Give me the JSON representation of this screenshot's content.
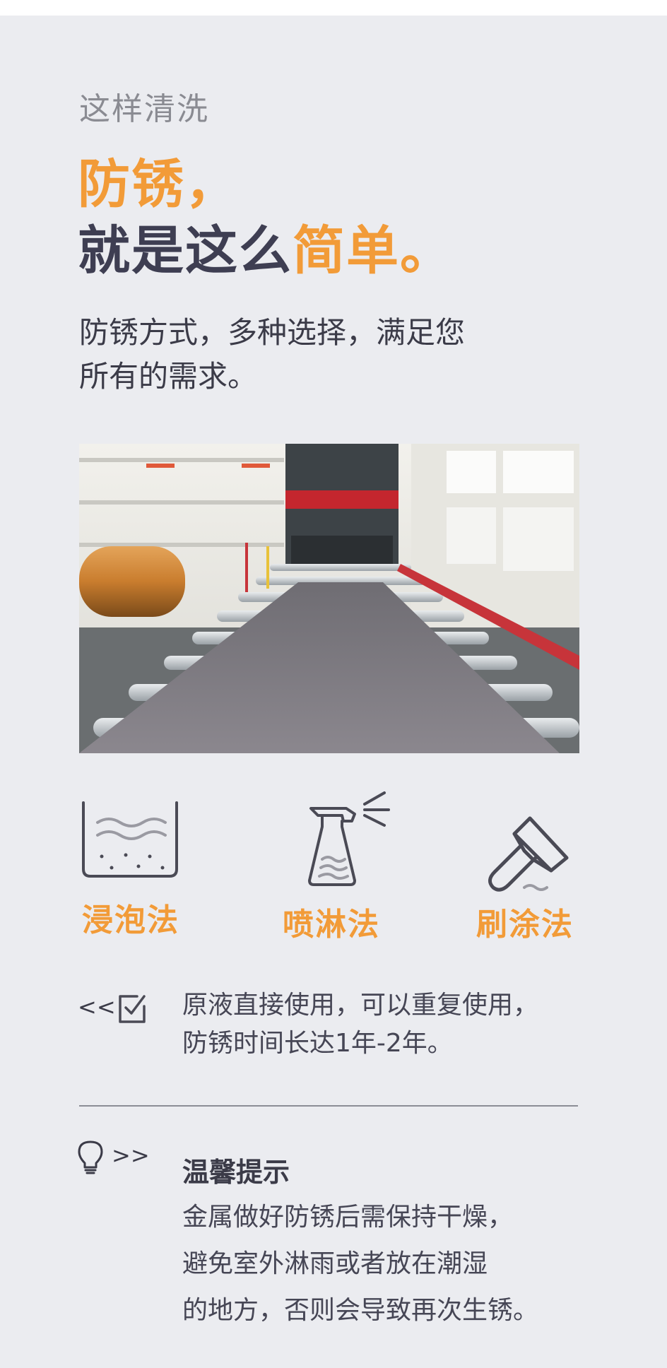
{
  "header": {
    "subtitle": "这样清洗",
    "headline_line1": "防锈，",
    "headline_line2_prefix": "就是这么",
    "headline_line2_accent": "简单。"
  },
  "intro": {
    "line1": "防锈方式，多种选择，满足您",
    "line2": "所有的需求。"
  },
  "methods": [
    {
      "label": "浸泡法",
      "icon": "immersion-tank-icon"
    },
    {
      "label": "喷淋法",
      "icon": "spray-bottle-icon"
    },
    {
      "label": "刷涂法",
      "icon": "paint-brush-icon"
    }
  ],
  "usage_note": {
    "arrow": "<<",
    "icon": "checkbox-icon",
    "line1": "原液直接使用，可以重复使用，",
    "line2": "防锈时间长达1年-2年。"
  },
  "tip": {
    "icon": "lightbulb-icon",
    "arrow": ">>",
    "title": "温馨提示",
    "line1": "金属做好防锈后需保持干燥，",
    "line2": "避免室外淋雨或者放在潮湿",
    "line3": "的地方，否则会导致再次生锈。"
  },
  "colors": {
    "accent": "#f29b38",
    "background": "#ebecf0",
    "text": "#3e3e52"
  }
}
